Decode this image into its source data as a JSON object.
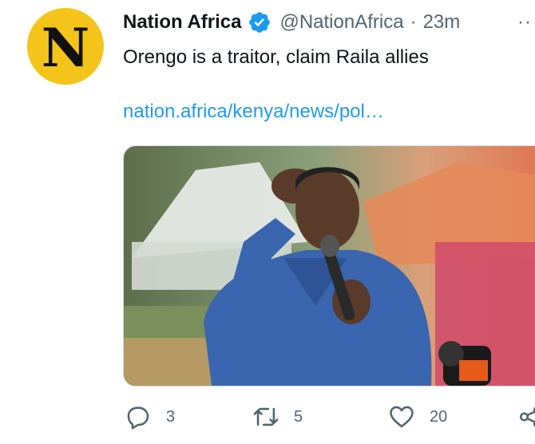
{
  "tweet": {
    "avatar_letter": "N",
    "author_name": "Nation Africa",
    "handle": "@NationAfrica",
    "separator": "·",
    "time": "23m",
    "text": "Orengo is a traitor, claim Raila allies",
    "link": "nation.africa/kenya/news/pol…",
    "more_label": "··"
  },
  "actions": {
    "reply_count": "3",
    "retweet_count": "5",
    "like_count": "20"
  },
  "icons": {
    "verified": "verified-badge-icon",
    "reply": "reply-icon",
    "retweet": "retweet-icon",
    "like": "heart-icon",
    "share": "share-icon",
    "more": "more-icon"
  },
  "colors": {
    "avatar_bg": "#f5c41b",
    "link": "#1d9bf0",
    "secondary_text": "#536471"
  }
}
